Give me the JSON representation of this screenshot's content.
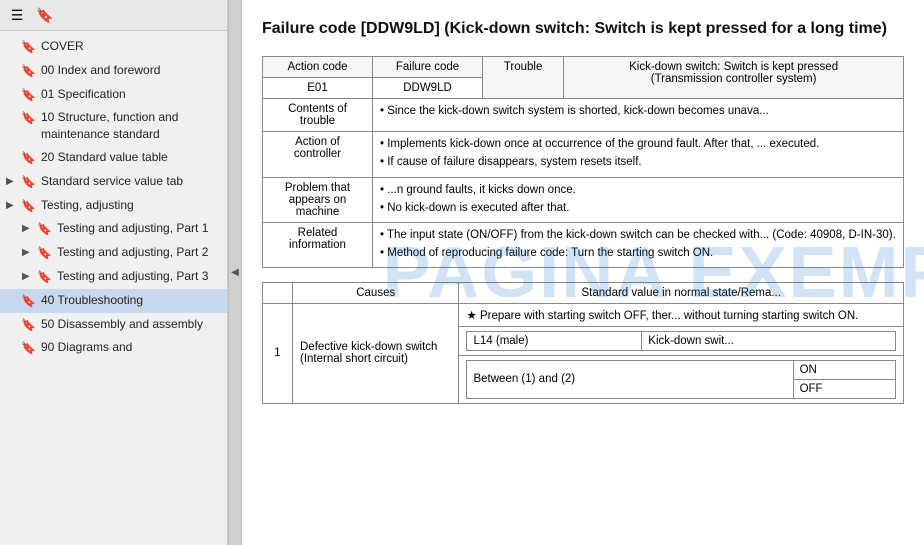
{
  "sidebar": {
    "toolbar": {
      "menu_icon": "☰",
      "bookmark_icon": "🔖"
    },
    "items": [
      {
        "id": "cover",
        "label": "COVER",
        "arrow": "",
        "indent": 0
      },
      {
        "id": "00-index",
        "label": "00 Index and foreword",
        "arrow": "",
        "indent": 0
      },
      {
        "id": "01-spec",
        "label": "01 Specification",
        "arrow": "",
        "indent": 0
      },
      {
        "id": "10-structure",
        "label": "10 Structure, function and maintenance standard",
        "arrow": "",
        "indent": 0
      },
      {
        "id": "20-standard",
        "label": "20 Standard value table",
        "arrow": "",
        "indent": 0
      },
      {
        "id": "standard-service",
        "label": "Standard service value tab",
        "arrow": "▶",
        "indent": 0
      },
      {
        "id": "testing-adj",
        "label": "Testing, adjusting",
        "arrow": "▶",
        "indent": 0
      },
      {
        "id": "testing-adj-1",
        "label": "Testing and adjusting, Part 1",
        "arrow": "▶",
        "indent": 1
      },
      {
        "id": "testing-adj-2",
        "label": "Testing and adjusting, Part 2",
        "arrow": "▶",
        "indent": 1
      },
      {
        "id": "testing-adj-3",
        "label": "Testing and adjusting, Part 3",
        "arrow": "▶",
        "indent": 1
      },
      {
        "id": "40-trouble",
        "label": "40 Troubleshooting",
        "arrow": "",
        "indent": 0,
        "active": true
      },
      {
        "id": "50-disassembly",
        "label": "50 Disassembly and assembly",
        "arrow": "",
        "indent": 0
      },
      {
        "id": "90-diagrams",
        "label": "90 Diagrams and",
        "arrow": "",
        "indent": 0
      }
    ]
  },
  "main": {
    "title": "Failure code [DDW9LD] (Kick-down switch: Switch is kept pressed for a long time)",
    "title_truncated": "Failure code [DDW9LD] (Kick-down switch: Switch is ke... long time)",
    "table1": {
      "headers": [
        "Action code",
        "Failure code",
        "Trouble"
      ],
      "action_code": "E01",
      "failure_code": "DDW9LD",
      "trouble": "Trouble",
      "trouble_desc": "Kick-down switch: Switch is kept pressed (Transmission controller system)",
      "rows": [
        {
          "label": "Contents of trouble",
          "content": "Since the kick-down switch system is shorted, kick-down becomes unava..."
        },
        {
          "label": "Action of controller",
          "content": "Implements kick-down once at occurrence of the ground fault. After that, ... executed.\nIf cause of failure disappears, system resets itself."
        },
        {
          "label": "Problem that appears on machine",
          "content": "...n ground faults, it kicks down once.\nNo kick-down is executed after that."
        },
        {
          "label": "Related information",
          "content": "The input state (ON/OFF) from the kick-down switch can be checked with... (Code: 40908, D-IN-30).\nMethod of reproducing failure code: Turn the starting switch ON."
        }
      ]
    },
    "table2": {
      "headers": [
        "Causes",
        "Standard value in normal state/Rema..."
      ],
      "rows": [
        {
          "num": "1",
          "cause": "Defective kick-down switch (Internal short circuit)",
          "sub_rows": [
            {
              "sub_label": "★ Prepare with starting switch OFF, ther... without turning starting switch ON."
            },
            {
              "sub_label": "L14 (male)",
              "value": "Kick-down swit..."
            },
            {
              "sub_label": "Between (1) and (2)",
              "value_on": "ON",
              "value_off": "OFF"
            }
          ]
        }
      ]
    }
  },
  "watermark": {
    "text": "PAGINA EXEMPLU"
  },
  "colors": {
    "accent_blue": "#1a5fa8",
    "watermark_blue": "rgba(0,100,200,0.18)"
  }
}
